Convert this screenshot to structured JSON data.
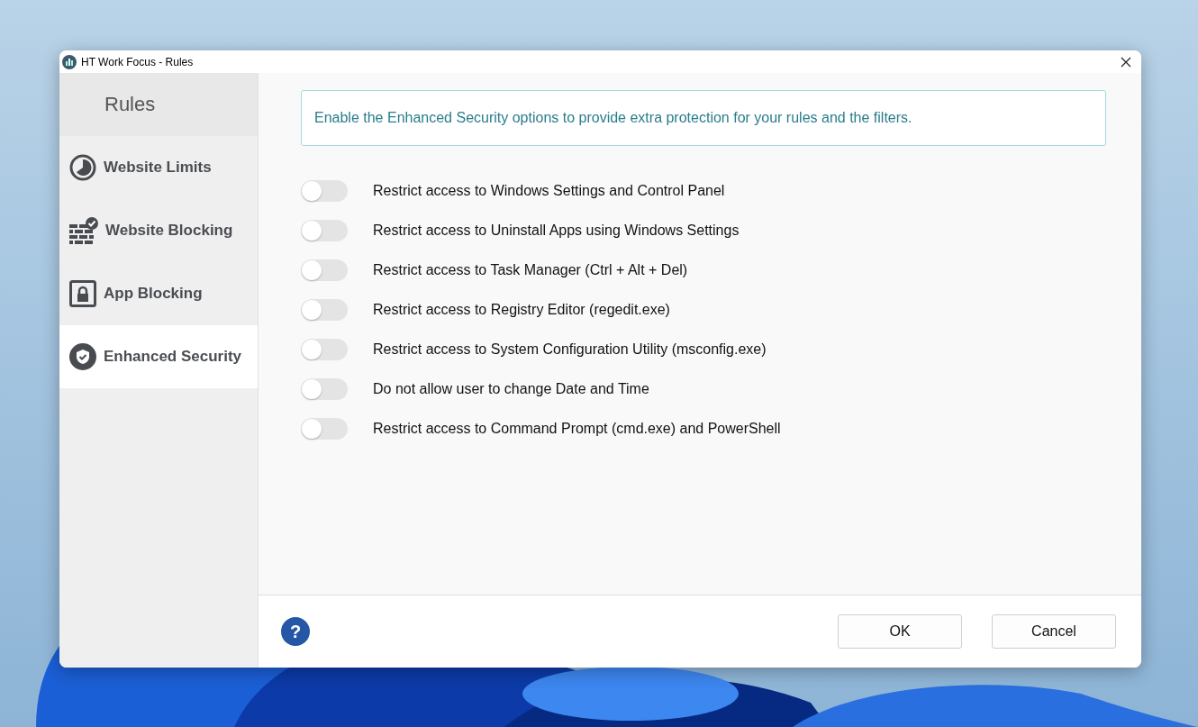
{
  "window": {
    "title": "HT Work Focus - Rules"
  },
  "sidebar": {
    "heading": "Rules",
    "items": [
      {
        "label": "Website Limits",
        "selected": false
      },
      {
        "label": "Website Blocking",
        "selected": false
      },
      {
        "label": "App Blocking",
        "selected": false
      },
      {
        "label": "Enhanced Security",
        "selected": true
      }
    ]
  },
  "info": "Enable the Enhanced Security options to provide extra protection for your rules and the filters.",
  "options": [
    {
      "label": "Restrict access to Windows Settings and Control Panel",
      "on": false
    },
    {
      "label": "Restrict access to Uninstall Apps using Windows Settings",
      "on": false
    },
    {
      "label": "Restrict access to Task Manager (Ctrl + Alt + Del)",
      "on": false
    },
    {
      "label": "Restrict access to Registry Editor (regedit.exe)",
      "on": false
    },
    {
      "label": "Restrict access to System Configuration Utility (msconfig.exe)",
      "on": false
    },
    {
      "label": "Do not allow user to change Date and Time",
      "on": false
    },
    {
      "label": "Restrict access to Command Prompt (cmd.exe) and PowerShell",
      "on": false
    }
  ],
  "footer": {
    "help": "?",
    "buttons": [
      "OK",
      "Cancel"
    ]
  }
}
